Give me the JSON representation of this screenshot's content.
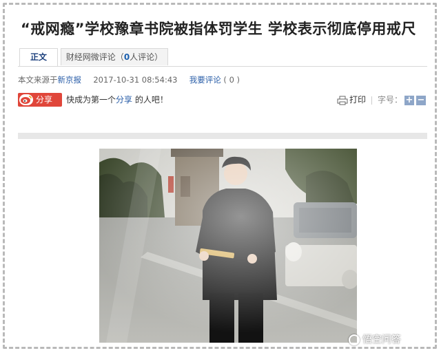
{
  "article": {
    "title": "“戒网瘾”学校豫章书院被指体罚学生 学校表示彻底停用戒尺"
  },
  "tabs": [
    {
      "label": "正文",
      "active": true
    },
    {
      "label_prefix": "财经网微评论（",
      "count": "0",
      "label_suffix": "人评论）",
      "active": false
    }
  ],
  "meta": {
    "source_prefix": "本文来源于",
    "source_name": "新京报",
    "datetime": "2017-10-31 08:54:43",
    "comment_link": "我要评论",
    "comment_count": "( 0 )"
  },
  "share": {
    "button_label": "分享",
    "text_before": "快成为第一个",
    "text_link": "分享",
    "text_after": "的人吧！"
  },
  "tools": {
    "print_label": "打印",
    "font_size_label": "字号：",
    "increase": "+",
    "decrease": "−"
  },
  "watermark": {
    "text": "悟空问答"
  },
  "colors": {
    "accent_blue": "#2a5ea8",
    "weibo_red": "#e0463a",
    "tab_border": "#d8d8d8"
  }
}
